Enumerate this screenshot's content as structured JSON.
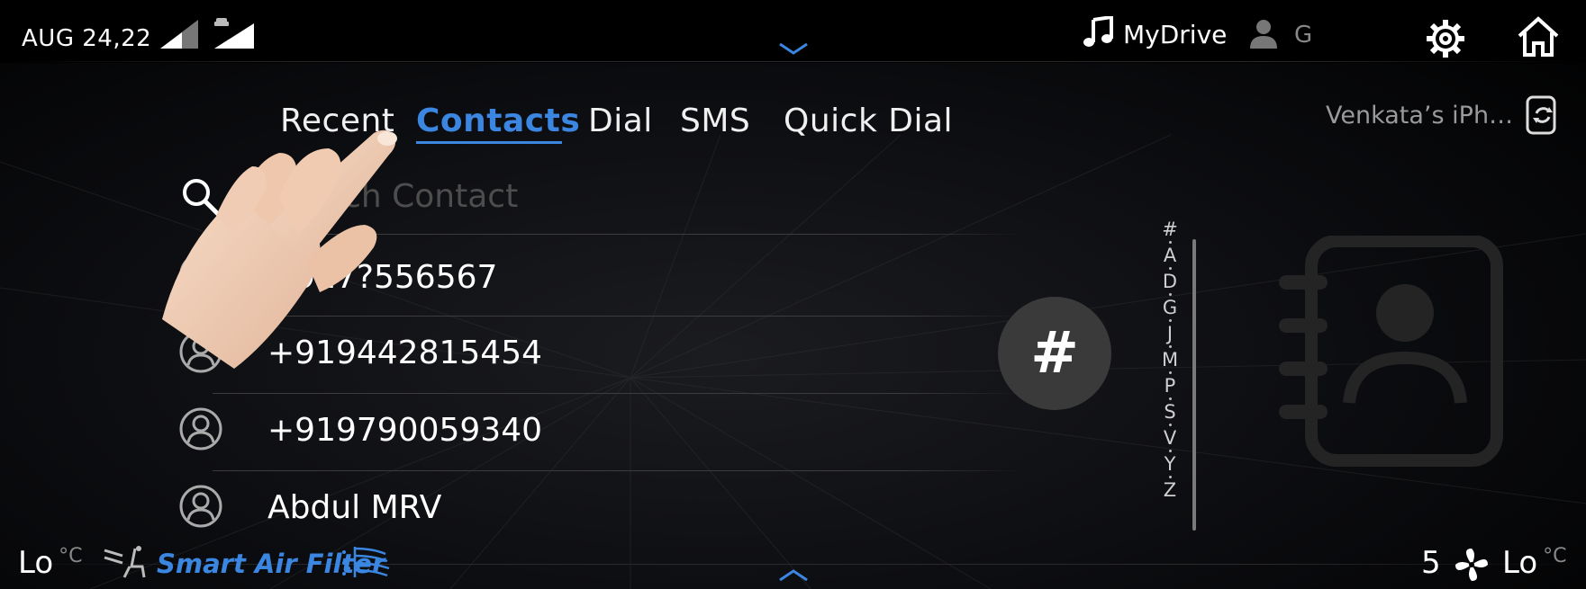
{
  "status_bar": {
    "date": "AUG 24,22",
    "media_label": "MyDrive",
    "user_initial": "G"
  },
  "tabs": [
    {
      "label": "Recent",
      "active": false
    },
    {
      "label": "Contacts",
      "active": true
    },
    {
      "label": "Dial",
      "active": false
    },
    {
      "label": "SMS",
      "active": false
    },
    {
      "label": "Quick Dial",
      "active": false
    }
  ],
  "device_name": "Venkata’s iPh…",
  "search": {
    "placeholder": "Search Contact",
    "visible_text": "Contact"
  },
  "contacts": [
    {
      "name": "+917?556567",
      "visible_name": "556567"
    },
    {
      "name": "+919442815454"
    },
    {
      "name": "+919790059340"
    },
    {
      "name": "Abdul MRV"
    }
  ],
  "index_bubble": "#",
  "alphabet_index": [
    "#",
    "A",
    "D",
    "G",
    "J",
    "M",
    "P",
    "S",
    "V",
    "Y",
    "Z"
  ],
  "climate": {
    "left_temp": "Lo",
    "left_unit": "°C",
    "air_filter_label": "Smart Air Filter",
    "fan_speed": "5",
    "right_temp": "Lo",
    "right_unit": "°C"
  },
  "colors": {
    "accent": "#3b86e0",
    "background": "#000000",
    "muted_text": "#9a9a9a"
  },
  "icons": {
    "signal": "signal-icon",
    "car_signal": "car-signal-icon",
    "music": "music-note-icon",
    "user": "user-icon",
    "settings": "gear-icon",
    "home": "home-icon",
    "phone_sync": "phone-sync-icon",
    "search": "search-icon",
    "contact_avatar": "avatar-icon",
    "seat": "seat-airflow-icon",
    "air_filter": "air-filter-icon",
    "fan": "fan-icon",
    "contacts_book": "contacts-book-icon",
    "touch_hand": "hand-pointer-icon"
  }
}
